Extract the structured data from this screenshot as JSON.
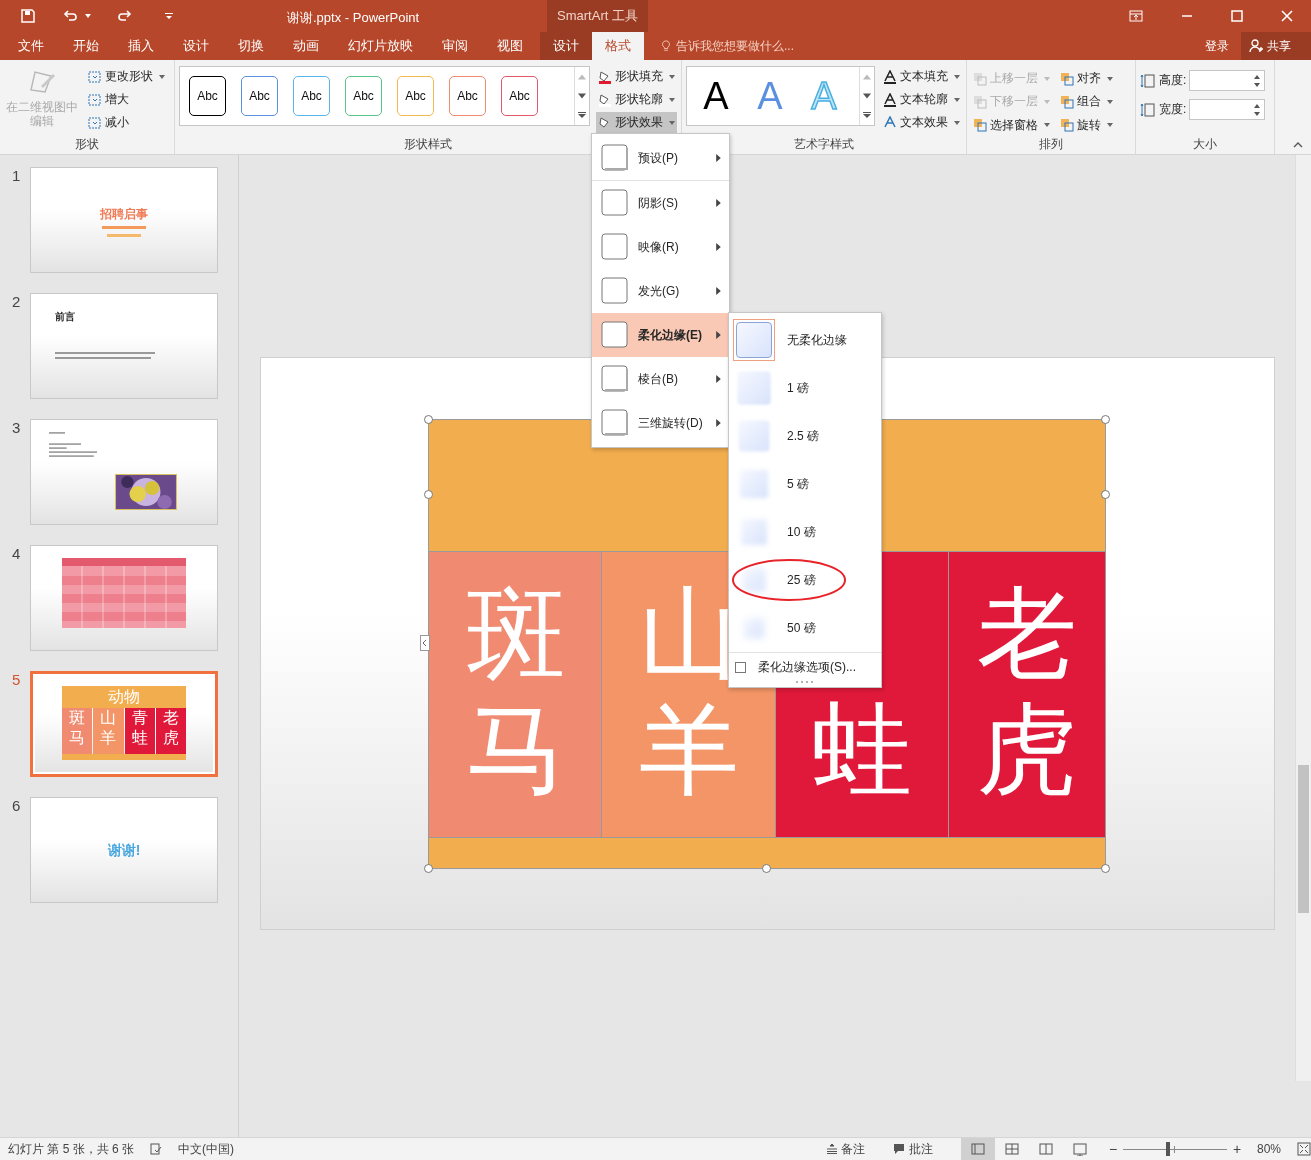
{
  "window": {
    "title": "谢谢.pptx - PowerPoint",
    "context_tab": "SmartArt 工具"
  },
  "tabs": [
    {
      "label": "文件",
      "context": false,
      "selected": false
    },
    {
      "label": "开始",
      "context": false,
      "selected": false
    },
    {
      "label": "插入",
      "context": false,
      "selected": false
    },
    {
      "label": "设计",
      "context": false,
      "selected": false
    },
    {
      "label": "切换",
      "context": false,
      "selected": false
    },
    {
      "label": "动画",
      "context": false,
      "selected": false
    },
    {
      "label": "幻灯片放映",
      "context": false,
      "selected": false
    },
    {
      "label": "审阅",
      "context": false,
      "selected": false
    },
    {
      "label": "视图",
      "context": false,
      "selected": false
    },
    {
      "label": "设计",
      "context": true,
      "selected": false
    },
    {
      "label": "格式",
      "context": true,
      "selected": true
    }
  ],
  "tell_me": {
    "placeholder": "告诉我您想要做什么..."
  },
  "account": {
    "sign_in": "登录",
    "share": "共享"
  },
  "ribbon": {
    "shapes": {
      "label": "形状",
      "edit_3d": {
        "label": "在二维视图中编辑",
        "disabled": true
      },
      "commands": [
        "更改形状",
        "增大",
        "减小"
      ]
    },
    "shape_styles": {
      "label": "形状样式",
      "swatches": [
        {
          "text": "Abc",
          "color": "#000000"
        },
        {
          "text": "Abc",
          "color": "#5b8fe0"
        },
        {
          "text": "Abc",
          "color": "#59b6e8"
        },
        {
          "text": "Abc",
          "color": "#5bc48a"
        },
        {
          "text": "Abc",
          "color": "#f5b94f"
        },
        {
          "text": "Abc",
          "color": "#ef8a6e"
        },
        {
          "text": "Abc",
          "color": "#e4576b"
        }
      ],
      "commands": [
        {
          "label": "形状填充",
          "selected": false
        },
        {
          "label": "形状轮廓",
          "selected": false
        },
        {
          "label": "形状效果",
          "selected": true
        }
      ]
    },
    "wordart": {
      "label": "艺术字样式",
      "samples": [
        {
          "text": "A",
          "kind": "plain"
        },
        {
          "text": "A",
          "kind": "blue"
        },
        {
          "text": "A",
          "kind": "outline"
        }
      ],
      "commands": [
        "文本填充",
        "文本轮廓",
        "文本效果"
      ]
    },
    "arrange": {
      "label": "排列",
      "items": [
        {
          "label": "上移一层",
          "disabled": true
        },
        {
          "label": "对齐",
          "disabled": false
        },
        {
          "label": "下移一层",
          "disabled": true
        },
        {
          "label": "组合",
          "disabled": false
        },
        {
          "label": "选择窗格",
          "disabled": false
        },
        {
          "label": "旋转",
          "disabled": false
        }
      ]
    },
    "size": {
      "label": "大小",
      "fields": [
        {
          "label": "高度:"
        },
        {
          "label": "宽度:"
        }
      ]
    }
  },
  "slides": [
    {
      "number": "1",
      "selected": false,
      "kind": "title",
      "title": "招聘启事"
    },
    {
      "number": "2",
      "selected": false,
      "kind": "text",
      "title": "前言"
    },
    {
      "number": "3",
      "selected": false,
      "kind": "text-picture"
    },
    {
      "number": "4",
      "selected": false,
      "kind": "table"
    },
    {
      "number": "5",
      "selected": true,
      "kind": "smartart",
      "title": "动物",
      "cells": [
        {
          "top": "斑",
          "bottom": "马"
        },
        {
          "top": "山",
          "bottom": "羊"
        },
        {
          "top": "青",
          "bottom": "蛙"
        },
        {
          "top": "老",
          "bottom": "虎"
        }
      ]
    },
    {
      "number": "6",
      "selected": false,
      "kind": "closing",
      "title": "谢谢!"
    }
  ],
  "slide": {
    "cells": [
      {
        "top": "斑",
        "bottom": "马",
        "color": "#f08a70"
      },
      {
        "top": "山",
        "bottom": "羊",
        "color": "#f39566"
      },
      {
        "bottom": "蛙",
        "color": "#e0193a"
      },
      {
        "top": "老",
        "bottom": "虎",
        "color": "#e0193a"
      }
    ]
  },
  "effects_menu": {
    "items": [
      {
        "label": "预设(P)",
        "selected": false
      },
      {
        "label": "阴影(S)",
        "selected": false
      },
      {
        "label": "映像(R)",
        "selected": false
      },
      {
        "label": "发光(G)",
        "selected": false
      },
      {
        "label": "柔化边缘(E)",
        "selected": true
      },
      {
        "label": "棱台(B)",
        "selected": false
      },
      {
        "label": "三维旋转(D)",
        "selected": false
      }
    ]
  },
  "soft_edge_menu": {
    "items": [
      {
        "label": "无柔化边缘",
        "selected": true,
        "circled": false
      },
      {
        "label": "1 磅",
        "selected": false,
        "circled": false
      },
      {
        "label": "2.5 磅",
        "selected": false,
        "circled": false
      },
      {
        "label": "5 磅",
        "selected": false,
        "circled": false
      },
      {
        "label": "10 磅",
        "selected": false,
        "circled": false
      },
      {
        "label": "25 磅",
        "selected": false,
        "circled": true
      },
      {
        "label": "50 磅",
        "selected": false,
        "circled": false
      }
    ],
    "options": {
      "label": "柔化边缘选项(S)...",
      "checked": false
    }
  },
  "status_bar": {
    "slide_info": "幻灯片 第 5 张，共 6 张",
    "language": "中文(中国)",
    "notes": "备注",
    "comments": "批注",
    "views": [
      {
        "selected": true
      },
      {
        "selected": false
      },
      {
        "selected": false
      },
      {
        "selected": false
      }
    ],
    "zoom": {
      "zoom_out": "−",
      "zoom_in": "+",
      "level": 0.43,
      "reading": "80%"
    }
  }
}
